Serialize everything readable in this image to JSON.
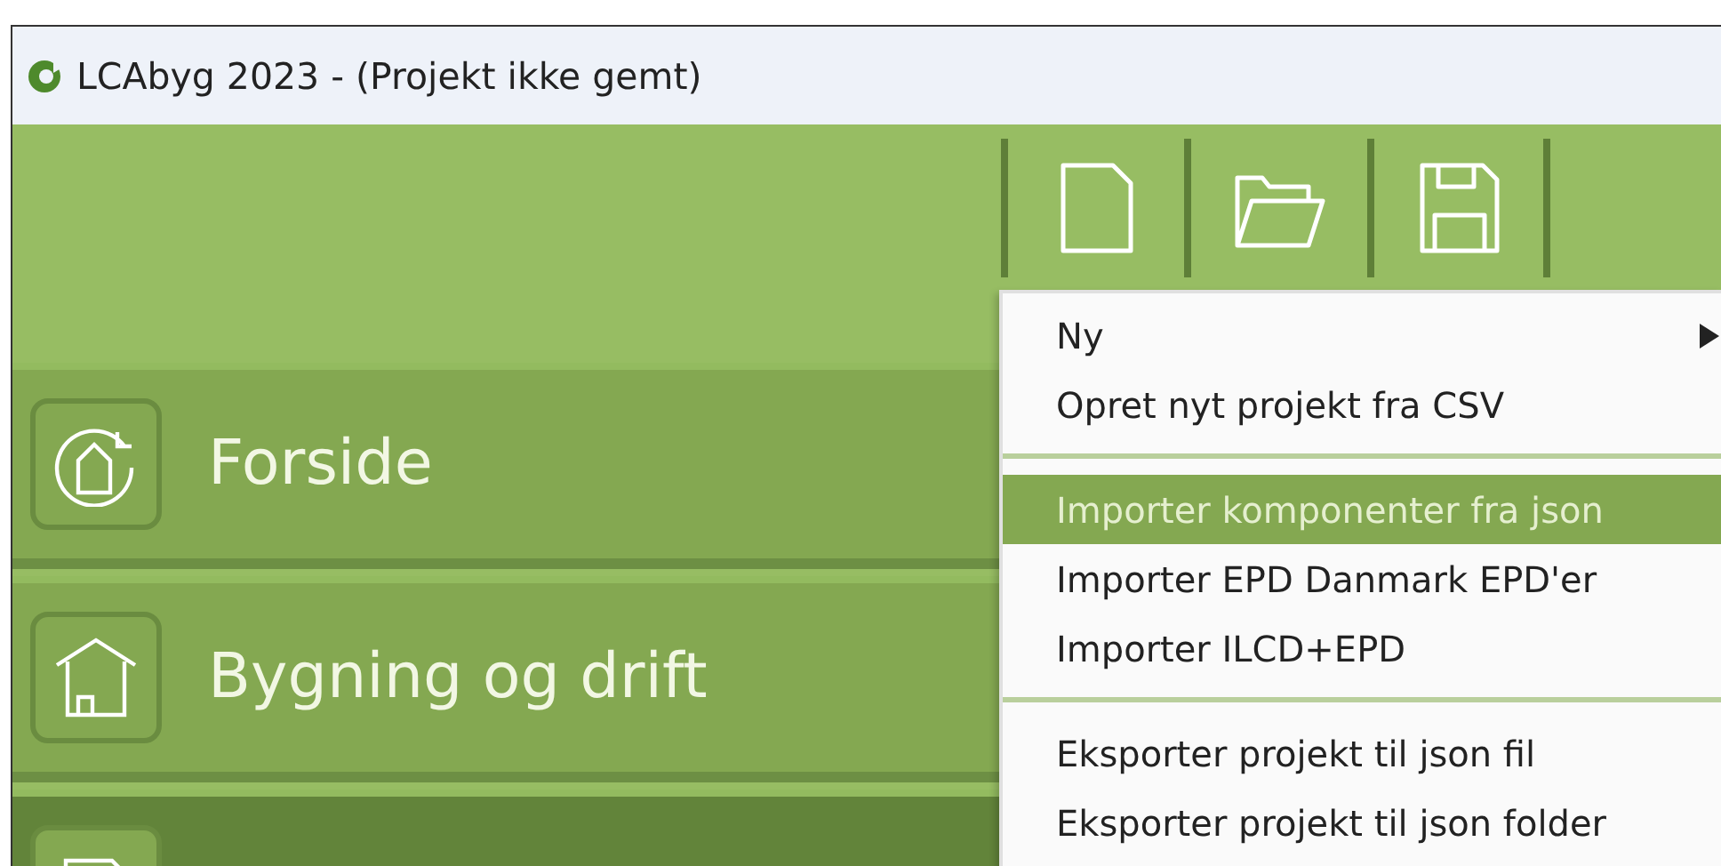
{
  "window": {
    "title": "LCAbyg 2023 - (Projekt ikke gemt)"
  },
  "toolbar": [
    {
      "kind": "new"
    },
    {
      "kind": "open"
    },
    {
      "kind": "save"
    }
  ],
  "nav": [
    {
      "label": "Forside",
      "kind": "home-cycle",
      "selected": false
    },
    {
      "label": "Bygning og drift",
      "kind": "house",
      "selected": false
    },
    {
      "kind": "document",
      "selected": true
    }
  ],
  "menu": {
    "groups": [
      [
        {
          "label": "Ny",
          "submenu": true,
          "highlighted": false
        },
        {
          "label": "Opret nyt projekt fra CSV",
          "submenu": false,
          "highlighted": false
        }
      ],
      [
        {
          "label": "Importer komponenter fra json",
          "submenu": false,
          "highlighted": true
        },
        {
          "label": "Importer EPD Danmark EPD'er",
          "submenu": false,
          "highlighted": false
        },
        {
          "label": "Importer ILCD+EPD",
          "submenu": false,
          "highlighted": false
        }
      ],
      [
        {
          "label": "Eksporter projekt til json fil",
          "submenu": false,
          "highlighted": false
        },
        {
          "label": "Eksporter projekt til json folder",
          "submenu": false,
          "highlighted": false
        }
      ]
    ]
  }
}
